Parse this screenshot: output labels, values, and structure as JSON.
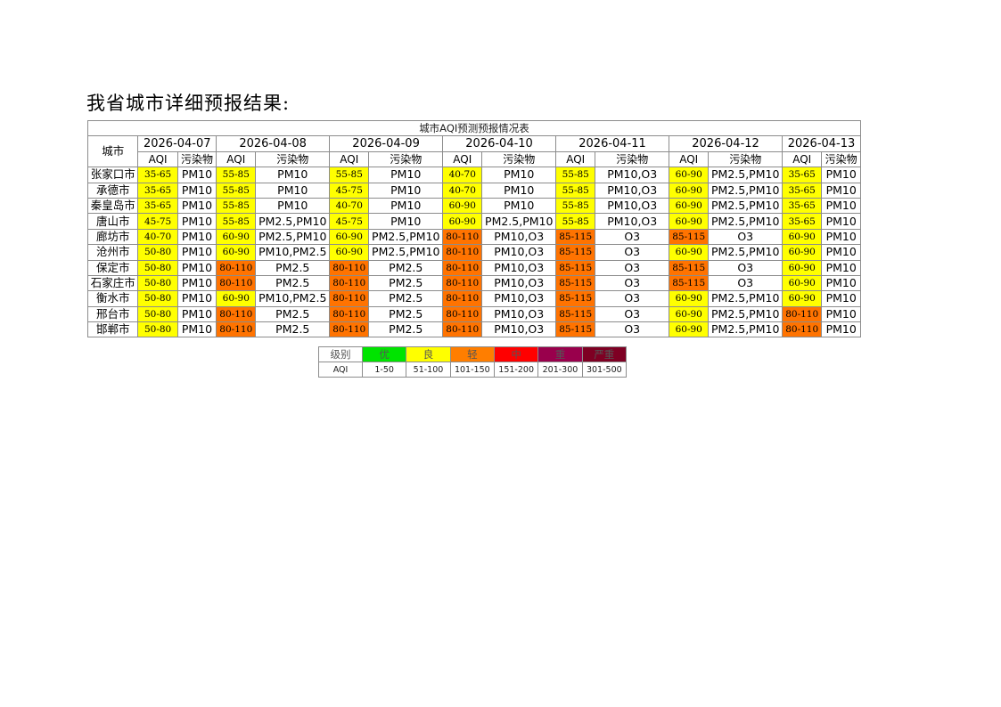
{
  "page": {
    "title": "我省城市详细预报结果:"
  },
  "table": {
    "caption": "城市AQI预测预报情况表",
    "city_header": "城市",
    "sub_aqi": "AQI",
    "sub_pollutant": "污染物",
    "dates": [
      "2026-04-07",
      "2026-04-08",
      "2026-04-09",
      "2026-04-10",
      "2026-04-11",
      "2026-04-12",
      "2026-04-13"
    ],
    "level_colors": {
      "yellow": "#ffff00",
      "orange": "#ff7300"
    },
    "rows": [
      {
        "city": "张家口市",
        "cells": [
          {
            "aqi": "35-65",
            "pol": "PM10",
            "lv": "yellow"
          },
          {
            "aqi": "55-85",
            "pol": "PM10",
            "lv": "yellow"
          },
          {
            "aqi": "55-85",
            "pol": "PM10",
            "lv": "yellow"
          },
          {
            "aqi": "40-70",
            "pol": "PM10",
            "lv": "yellow"
          },
          {
            "aqi": "55-85",
            "pol": "PM10,O3",
            "lv": "yellow"
          },
          {
            "aqi": "60-90",
            "pol": "PM2.5,PM10",
            "lv": "yellow"
          },
          {
            "aqi": "35-65",
            "pol": "PM10",
            "lv": "yellow"
          }
        ]
      },
      {
        "city": "承德市",
        "cells": [
          {
            "aqi": "35-65",
            "pol": "PM10",
            "lv": "yellow"
          },
          {
            "aqi": "55-85",
            "pol": "PM10",
            "lv": "yellow"
          },
          {
            "aqi": "45-75",
            "pol": "PM10",
            "lv": "yellow"
          },
          {
            "aqi": "40-70",
            "pol": "PM10",
            "lv": "yellow"
          },
          {
            "aqi": "55-85",
            "pol": "PM10,O3",
            "lv": "yellow"
          },
          {
            "aqi": "60-90",
            "pol": "PM2.5,PM10",
            "lv": "yellow"
          },
          {
            "aqi": "35-65",
            "pol": "PM10",
            "lv": "yellow"
          }
        ]
      },
      {
        "city": "秦皇岛市",
        "cells": [
          {
            "aqi": "35-65",
            "pol": "PM10",
            "lv": "yellow"
          },
          {
            "aqi": "55-85",
            "pol": "PM10",
            "lv": "yellow"
          },
          {
            "aqi": "40-70",
            "pol": "PM10",
            "lv": "yellow"
          },
          {
            "aqi": "60-90",
            "pol": "PM10",
            "lv": "yellow"
          },
          {
            "aqi": "55-85",
            "pol": "PM10,O3",
            "lv": "yellow"
          },
          {
            "aqi": "60-90",
            "pol": "PM2.5,PM10",
            "lv": "yellow"
          },
          {
            "aqi": "35-65",
            "pol": "PM10",
            "lv": "yellow"
          }
        ]
      },
      {
        "city": "唐山市",
        "cells": [
          {
            "aqi": "45-75",
            "pol": "PM10",
            "lv": "yellow"
          },
          {
            "aqi": "55-85",
            "pol": "PM2.5,PM10",
            "lv": "yellow"
          },
          {
            "aqi": "45-75",
            "pol": "PM10",
            "lv": "yellow"
          },
          {
            "aqi": "60-90",
            "pol": "PM2.5,PM10",
            "lv": "yellow"
          },
          {
            "aqi": "55-85",
            "pol": "PM10,O3",
            "lv": "yellow"
          },
          {
            "aqi": "60-90",
            "pol": "PM2.5,PM10",
            "lv": "yellow"
          },
          {
            "aqi": "35-65",
            "pol": "PM10",
            "lv": "yellow"
          }
        ]
      },
      {
        "city": "廊坊市",
        "cells": [
          {
            "aqi": "40-70",
            "pol": "PM10",
            "lv": "yellow"
          },
          {
            "aqi": "60-90",
            "pol": "PM2.5,PM10",
            "lv": "yellow"
          },
          {
            "aqi": "60-90",
            "pol": "PM2.5,PM10",
            "lv": "yellow"
          },
          {
            "aqi": "80-110",
            "pol": "PM10,O3",
            "lv": "orange"
          },
          {
            "aqi": "85-115",
            "pol": "O3",
            "lv": "orange"
          },
          {
            "aqi": "85-115",
            "pol": "O3",
            "lv": "orange"
          },
          {
            "aqi": "60-90",
            "pol": "PM10",
            "lv": "yellow"
          }
        ]
      },
      {
        "city": "沧州市",
        "cells": [
          {
            "aqi": "50-80",
            "pol": "PM10",
            "lv": "yellow"
          },
          {
            "aqi": "60-90",
            "pol": "PM10,PM2.5",
            "lv": "yellow"
          },
          {
            "aqi": "60-90",
            "pol": "PM2.5,PM10",
            "lv": "yellow"
          },
          {
            "aqi": "80-110",
            "pol": "PM10,O3",
            "lv": "orange"
          },
          {
            "aqi": "85-115",
            "pol": "O3",
            "lv": "orange"
          },
          {
            "aqi": "60-90",
            "pol": "PM2.5,PM10",
            "lv": "yellow"
          },
          {
            "aqi": "60-90",
            "pol": "PM10",
            "lv": "yellow"
          }
        ]
      },
      {
        "city": "保定市",
        "cells": [
          {
            "aqi": "50-80",
            "pol": "PM10",
            "lv": "yellow"
          },
          {
            "aqi": "80-110",
            "pol": "PM2.5",
            "lv": "orange"
          },
          {
            "aqi": "80-110",
            "pol": "PM2.5",
            "lv": "orange"
          },
          {
            "aqi": "80-110",
            "pol": "PM10,O3",
            "lv": "orange"
          },
          {
            "aqi": "85-115",
            "pol": "O3",
            "lv": "orange"
          },
          {
            "aqi": "85-115",
            "pol": "O3",
            "lv": "orange"
          },
          {
            "aqi": "60-90",
            "pol": "PM10",
            "lv": "yellow"
          }
        ]
      },
      {
        "city": "石家庄市",
        "cells": [
          {
            "aqi": "50-80",
            "pol": "PM10",
            "lv": "yellow"
          },
          {
            "aqi": "80-110",
            "pol": "PM2.5",
            "lv": "orange"
          },
          {
            "aqi": "80-110",
            "pol": "PM2.5",
            "lv": "orange"
          },
          {
            "aqi": "80-110",
            "pol": "PM10,O3",
            "lv": "orange"
          },
          {
            "aqi": "85-115",
            "pol": "O3",
            "lv": "orange"
          },
          {
            "aqi": "85-115",
            "pol": "O3",
            "lv": "orange"
          },
          {
            "aqi": "60-90",
            "pol": "PM10",
            "lv": "yellow"
          }
        ]
      },
      {
        "city": "衡水市",
        "cells": [
          {
            "aqi": "50-80",
            "pol": "PM10",
            "lv": "yellow"
          },
          {
            "aqi": "60-90",
            "pol": "PM10,PM2.5",
            "lv": "yellow"
          },
          {
            "aqi": "80-110",
            "pol": "PM2.5",
            "lv": "orange"
          },
          {
            "aqi": "80-110",
            "pol": "PM10,O3",
            "lv": "orange"
          },
          {
            "aqi": "85-115",
            "pol": "O3",
            "lv": "orange"
          },
          {
            "aqi": "60-90",
            "pol": "PM2.5,PM10",
            "lv": "yellow"
          },
          {
            "aqi": "60-90",
            "pol": "PM10",
            "lv": "yellow"
          }
        ]
      },
      {
        "city": "邢台市",
        "cells": [
          {
            "aqi": "50-80",
            "pol": "PM10",
            "lv": "yellow"
          },
          {
            "aqi": "80-110",
            "pol": "PM2.5",
            "lv": "orange"
          },
          {
            "aqi": "80-110",
            "pol": "PM2.5",
            "lv": "orange"
          },
          {
            "aqi": "80-110",
            "pol": "PM10,O3",
            "lv": "orange"
          },
          {
            "aqi": "85-115",
            "pol": "O3",
            "lv": "orange"
          },
          {
            "aqi": "60-90",
            "pol": "PM2.5,PM10",
            "lv": "yellow"
          },
          {
            "aqi": "80-110",
            "pol": "PM10",
            "lv": "orange"
          }
        ]
      },
      {
        "city": "邯郸市",
        "cells": [
          {
            "aqi": "50-80",
            "pol": "PM10",
            "lv": "yellow"
          },
          {
            "aqi": "80-110",
            "pol": "PM2.5",
            "lv": "orange"
          },
          {
            "aqi": "80-110",
            "pol": "PM2.5",
            "lv": "orange"
          },
          {
            "aqi": "80-110",
            "pol": "PM10,O3",
            "lv": "orange"
          },
          {
            "aqi": "85-115",
            "pol": "O3",
            "lv": "orange"
          },
          {
            "aqi": "60-90",
            "pol": "PM2.5,PM10",
            "lv": "yellow"
          },
          {
            "aqi": "80-110",
            "pol": "PM10",
            "lv": "orange"
          }
        ]
      }
    ]
  },
  "legend": {
    "row_label_level": "级别",
    "row_label_aqi": "AQI",
    "levels": [
      {
        "name": "优",
        "range": "1-50",
        "color": "#00e400"
      },
      {
        "name": "良",
        "range": "51-100",
        "color": "#ffff00"
      },
      {
        "name": "轻",
        "range": "101-150",
        "color": "#ff7e00"
      },
      {
        "name": "中",
        "range": "151-200",
        "color": "#ff0000"
      },
      {
        "name": "重",
        "range": "201-300",
        "color": "#99004c"
      },
      {
        "name": "严重",
        "range": "301-500",
        "color": "#7e0023"
      }
    ]
  }
}
